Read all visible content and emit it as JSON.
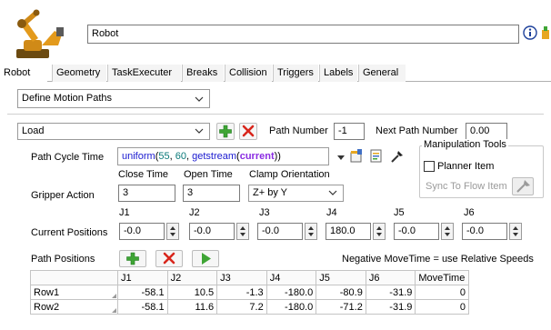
{
  "header": {
    "object_name": "Robot",
    "info_icon": "info-icon",
    "logo_icon": "robot-arm-icon"
  },
  "tabs": [
    {
      "label": "Robot",
      "active": true
    },
    {
      "label": "Geometry",
      "active": false
    },
    {
      "label": "TaskExecuter",
      "active": false
    },
    {
      "label": "Breaks",
      "active": false
    },
    {
      "label": "Collision",
      "active": false
    },
    {
      "label": "Triggers",
      "active": false
    },
    {
      "label": "Labels",
      "active": false
    },
    {
      "label": "General",
      "active": false
    }
  ],
  "mode_select": {
    "value": "Define Motion Paths"
  },
  "path_select": {
    "value": "Load"
  },
  "path_number": {
    "label": "Path Number",
    "value": "-1"
  },
  "next_path_number": {
    "label": "Next Path Number",
    "value": "0.00"
  },
  "cycle_time": {
    "label": "Path Cycle Time",
    "fn": "uniform",
    "open": "(",
    "a": "55",
    "comma1": ", ",
    "b": "60",
    "comma2": ", ",
    "fn2": "getstream",
    "open2": "(",
    "arg": "current",
    "close": "))"
  },
  "manipulation_tools": {
    "title": "Manipulation Tools",
    "planner_item": "Planner Item",
    "sync_to_flow_item": "Sync To Flow Item"
  },
  "gripper": {
    "label": "Gripper Action",
    "close_time_label": "Close Time",
    "close_time": "3",
    "open_time_label": "Open Time",
    "open_time": "3",
    "clamp_label": "Clamp Orientation",
    "clamp_value": "Z+ by Y"
  },
  "current_positions": {
    "label": "Current Positions",
    "joints": [
      {
        "name": "J1",
        "value": "-0.0"
      },
      {
        "name": "J2",
        "value": "-0.0"
      },
      {
        "name": "J3",
        "value": "-0.0"
      },
      {
        "name": "J4",
        "value": "180.0"
      },
      {
        "name": "J5",
        "value": "-0.0"
      },
      {
        "name": "J6",
        "value": "-0.0"
      }
    ]
  },
  "path_positions": {
    "label": "Path Positions",
    "note": "Negative MoveTime = use Relative Speeds",
    "columns": [
      "",
      "J1",
      "J2",
      "J3",
      "J4",
      "J5",
      "J6",
      "MoveTime"
    ],
    "rows": [
      [
        "Row1",
        "-58.1",
        "10.5",
        "-1.3",
        "-180.0",
        "-80.9",
        "-31.9",
        "0"
      ],
      [
        "Row2",
        "-58.1",
        "11.6",
        "7.2",
        "-180.0",
        "-71.2",
        "-31.9",
        "0"
      ]
    ]
  },
  "colors": {
    "accent_green": "#3fa535",
    "delete_red": "#d8261c",
    "code_blue": "#1a1ad0",
    "code_purple": "#8a2be2",
    "code_number": "#0a7a7a"
  }
}
